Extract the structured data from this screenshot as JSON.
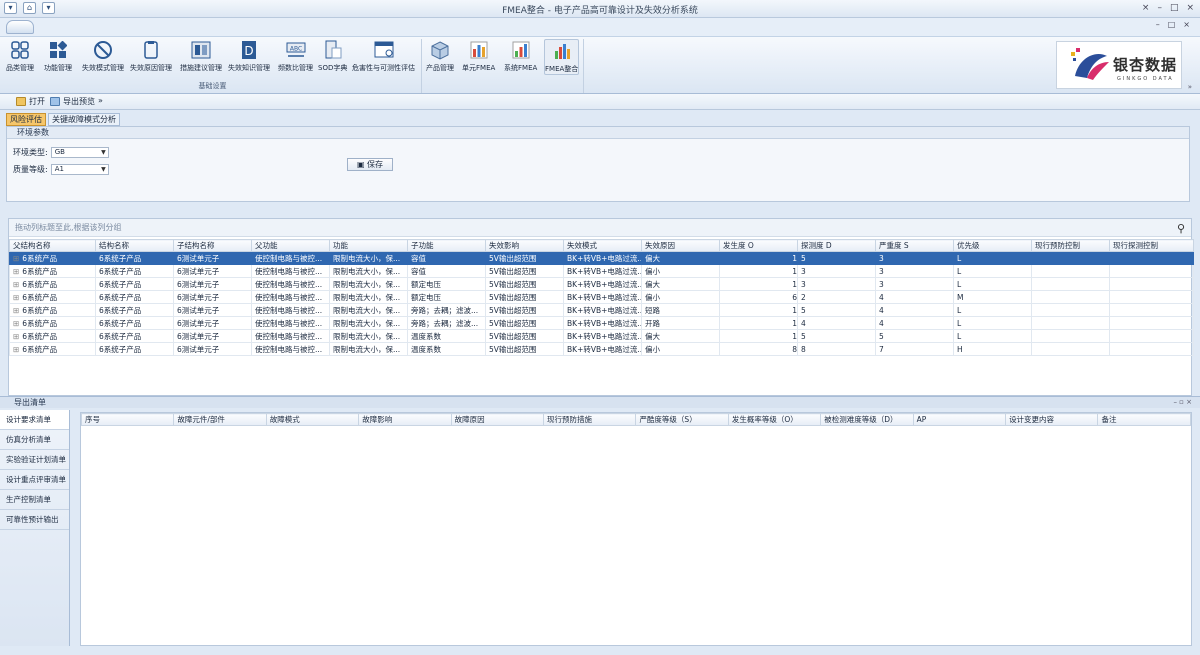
{
  "window": {
    "title": "FMEA整合 - 电子产品高可靠设计及失效分析系统",
    "controls": [
      "×",
      "–",
      "□",
      "×"
    ],
    "mdi_controls": [
      "–",
      "□",
      "×"
    ]
  },
  "ribbon": {
    "groups": [
      {
        "caption": "基础设置",
        "buttons": [
          {
            "label": "品类管理",
            "icon": "grid-icon"
          },
          {
            "label": "功能管理",
            "icon": "blocks-icon"
          },
          {
            "label": "失效模式管理",
            "icon": "prohibit-icon"
          },
          {
            "label": "失效原因管理",
            "icon": "document-icon"
          },
          {
            "label": "措施建议管理",
            "icon": "panel-icon"
          },
          {
            "label": "失效知识管理",
            "icon": "d-letter-icon"
          },
          {
            "label": "频数比管理",
            "icon": "abc-icon"
          },
          {
            "label": "SOD字典",
            "icon": "book-icon"
          },
          {
            "label": "危害性与可测性评估",
            "icon": "window-icon"
          }
        ]
      },
      {
        "caption": "",
        "buttons": [
          {
            "label": "产品管理",
            "icon": "cube-icon"
          },
          {
            "label": "单元FMEA",
            "icon": "bar-chart-icon"
          },
          {
            "label": "系统FMEA",
            "icon": "bar-chart-icon"
          },
          {
            "label": "FMEA整合",
            "icon": "bar-chart-icon"
          }
        ]
      }
    ],
    "logo": {
      "text": "银杏数据",
      "sub": "GINKGO DATA"
    },
    "collapse_glyph": "»"
  },
  "toolbar": {
    "items": [
      {
        "label": "打开"
      },
      {
        "label": "导出预览"
      }
    ],
    "more_glyph": "»"
  },
  "doc_tabs": [
    {
      "label": "风险评估"
    },
    {
      "label": "关键故障模式分析"
    }
  ],
  "env_panel": {
    "caption": "环境参数",
    "env_type_label": "环境类型:",
    "env_type_value": "GB",
    "quality_label": "质量等级:",
    "quality_value": "A1",
    "save_label": "保存"
  },
  "grid": {
    "group_hint": "拖动列标题至此,根据该列分组",
    "columns": [
      "父结构名称",
      "结构名称",
      "子结构名称",
      "父功能",
      "功能",
      "子功能",
      "失效影响",
      "失效模式",
      "失效原因",
      "发生度 O",
      "探测度 D",
      "严重度 S",
      "优先级",
      "现行预防控制",
      "现行探测控制"
    ],
    "rows": [
      [
        "6系统产品",
        "6系统子产品",
        "6测试单元子",
        "使控制电路与被控...",
        "限制电流大小，保...",
        "容值",
        "5V输出超范围",
        "BK+转VB+电路过流...",
        "偏大",
        "1",
        "5",
        "3",
        "L",
        "",
        ""
      ],
      [
        "6系统产品",
        "6系统子产品",
        "6测试单元子",
        "使控制电路与被控...",
        "限制电流大小，保...",
        "容值",
        "5V输出超范围",
        "BK+转VB+电路过流...",
        "偏小",
        "1",
        "3",
        "3",
        "L",
        "",
        ""
      ],
      [
        "6系统产品",
        "6系统子产品",
        "6测试单元子",
        "使控制电路与被控...",
        "限制电流大小，保...",
        "额定电压",
        "5V输出超范围",
        "BK+转VB+电路过流...",
        "偏大",
        "1",
        "3",
        "3",
        "L",
        "",
        ""
      ],
      [
        "6系统产品",
        "6系统子产品",
        "6测试单元子",
        "使控制电路与被控...",
        "限制电流大小，保...",
        "额定电压",
        "5V输出超范围",
        "BK+转VB+电路过流...",
        "偏小",
        "6",
        "2",
        "4",
        "M",
        "",
        ""
      ],
      [
        "6系统产品",
        "6系统子产品",
        "6测试单元子",
        "使控制电路与被控...",
        "限制电流大小，保...",
        "旁路；去耦；滤波...",
        "5V输出超范围",
        "BK+转VB+电路过流...",
        "短路",
        "1",
        "5",
        "4",
        "L",
        "",
        ""
      ],
      [
        "6系统产品",
        "6系统子产品",
        "6测试单元子",
        "使控制电路与被控...",
        "限制电流大小，保...",
        "旁路；去耦；滤波...",
        "5V输出超范围",
        "BK+转VB+电路过流...",
        "开路",
        "1",
        "4",
        "4",
        "L",
        "",
        ""
      ],
      [
        "6系统产品",
        "6系统子产品",
        "6测试单元子",
        "使控制电路与被控...",
        "限制电流大小，保...",
        "温度系数",
        "5V输出超范围",
        "BK+转VB+电路过流...",
        "偏大",
        "1",
        "5",
        "5",
        "L",
        "",
        ""
      ],
      [
        "6系统产品",
        "6系统子产品",
        "6测试单元子",
        "使控制电路与被控...",
        "限制电流大小，保...",
        "温度系数",
        "5V输出超范围",
        "BK+转VB+电路过流...",
        "偏小",
        "8",
        "8",
        "7",
        "H",
        "",
        ""
      ]
    ]
  },
  "export_dock": {
    "caption": "导出清单",
    "ctrls": "– ▫ ×",
    "nav": [
      {
        "label": "设计要求清单"
      },
      {
        "label": "仿真分析清单"
      },
      {
        "label": "实验验证计划清单"
      },
      {
        "label": "设计重点评审清单"
      },
      {
        "label": "生产控制清单"
      },
      {
        "label": "可靠性预计输出"
      }
    ],
    "columns": [
      "序号",
      "故障元件/部件",
      "故障模式",
      "故障影响",
      "故障原因",
      "现行预防措施",
      "严酷度等级（S）",
      "发生概率等级（O）",
      "被检测难度等级（D）",
      "AP",
      "设计变更内容",
      "备注"
    ]
  },
  "colors": {
    "accent": "#2f67b0",
    "active_tab": "#f6c66a"
  }
}
